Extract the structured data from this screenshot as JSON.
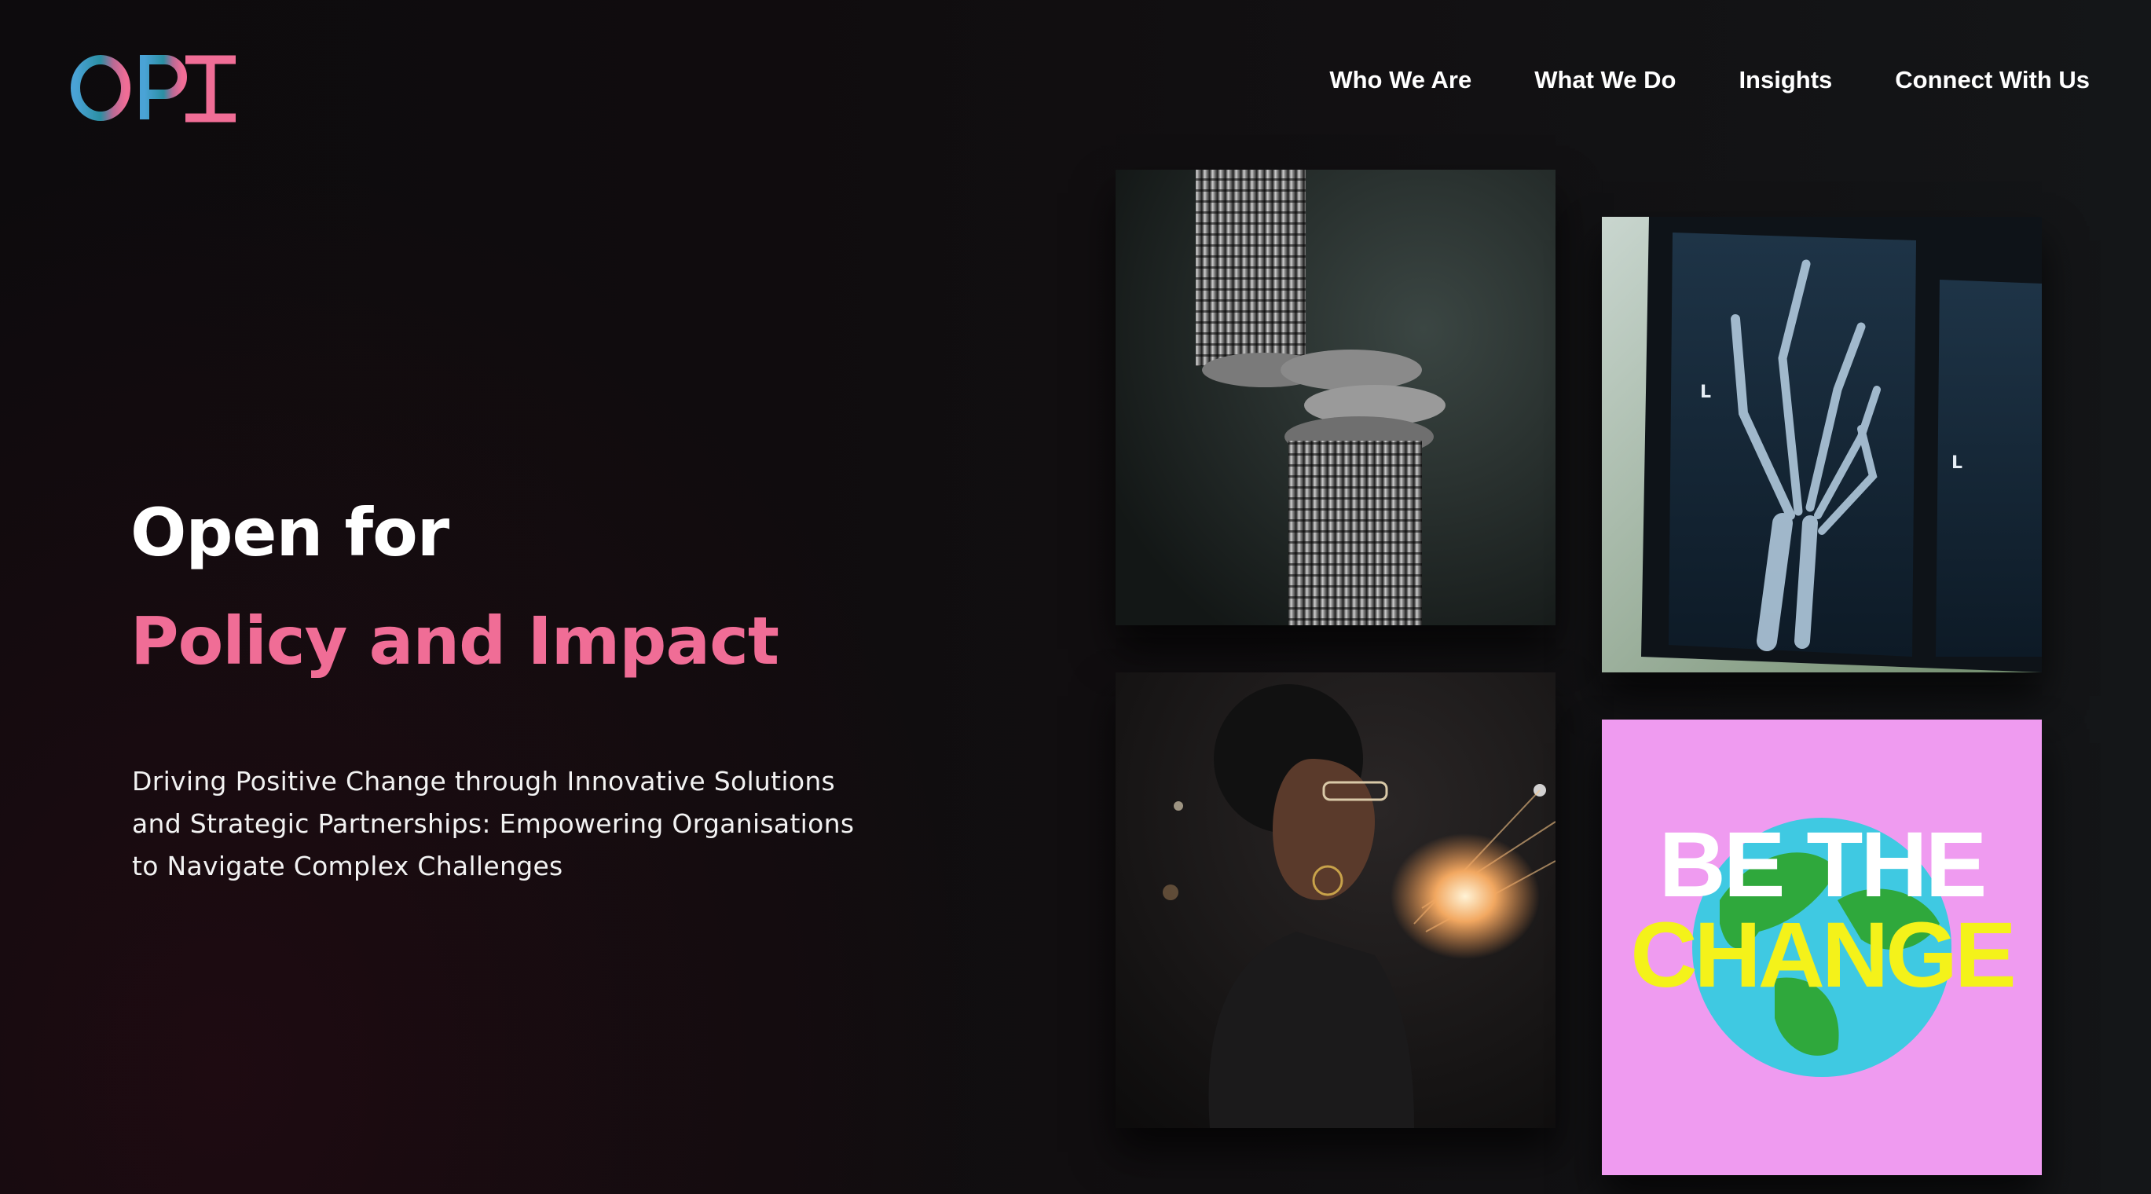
{
  "logo": {
    "text": "OPI",
    "colors": {
      "blue": "#4aa3d6",
      "teal": "#2b8fa3",
      "pink": "#f06d96"
    }
  },
  "nav": {
    "items": [
      {
        "label": "Who We Are"
      },
      {
        "label": "What We Do"
      },
      {
        "label": "Insights"
      },
      {
        "label": "Connect With Us"
      }
    ]
  },
  "hero": {
    "title_line1": "Open for",
    "title_line2": "Policy and Impact",
    "description": "Driving Positive Change through Innovative Solutions and Strategic Partnerships: Empowering Organisations to Navigate Complex Challenges"
  },
  "tiles": {
    "coins": {
      "alt": "stacked-coins-photo"
    },
    "xray": {
      "alt": "hand-xray-photo"
    },
    "woman": {
      "alt": "woman-holding-light-photo"
    },
    "change": {
      "line1": "BE THE",
      "line2": "CHANGE"
    }
  },
  "colors": {
    "accent": "#f06d96",
    "background": "#100c0e",
    "tile_pink": "#ef9bf0"
  }
}
